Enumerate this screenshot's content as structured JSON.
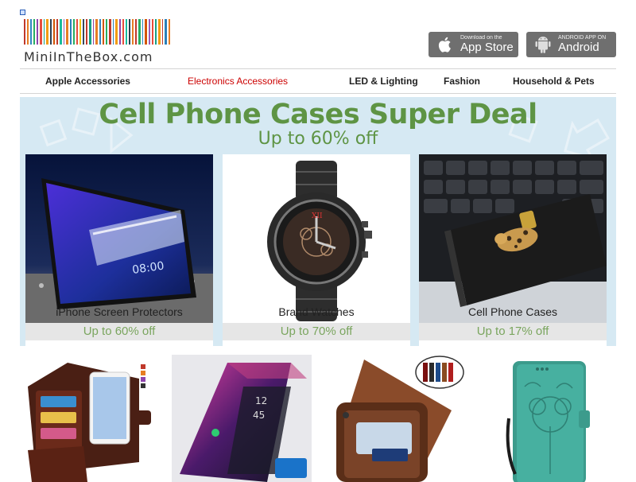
{
  "logo": {
    "text": "MiniInTheBox.com",
    "bar_colors": [
      "#c0392b",
      "#e67e22",
      "#2e86c1",
      "#27ae60",
      "#8e44ad",
      "#e74c3c",
      "#16a085",
      "#f39c12",
      "#2c3e50",
      "#d35400",
      "#c0392b",
      "#1abc9c",
      "#9b59b6",
      "#e67e22",
      "#2980b9",
      "#27ae60",
      "#e74c3c",
      "#f1c40f",
      "#34495e",
      "#c0392b",
      "#16a085",
      "#8e44ad",
      "#e67e22",
      "#2e86c1",
      "#d35400",
      "#27ae60",
      "#c0392b",
      "#2980b9",
      "#f39c12",
      "#8e44ad",
      "#e74c3c",
      "#1abc9c",
      "#2c3e50",
      "#e67e22",
      "#c0392b",
      "#27ae60",
      "#2e86c1",
      "#d35400",
      "#9b59b6",
      "#e74c3c",
      "#16a085",
      "#f39c12",
      "#c0392b",
      "#2980b9",
      "#e67e22"
    ]
  },
  "apps": {
    "ios": {
      "small": "Download on the",
      "big": "App Store",
      "icon": "apple-icon"
    },
    "android": {
      "small": "ANDROID APP ON",
      "big": "Android",
      "icon": "android-icon"
    }
  },
  "nav": [
    {
      "label": "Apple Accessories"
    },
    {
      "label": "Electronics Accessories",
      "active": true
    },
    {
      "label": "LED & Lighting"
    },
    {
      "label": "Fashion"
    },
    {
      "label": "Household & Pets"
    }
  ],
  "banner": {
    "title": "Cell Phone Cases Super Deal",
    "subtitle": "Up to 60% off",
    "deals": [
      {
        "caption": "iPhone Screen Protectors",
        "discount": "Up to 60% off"
      },
      {
        "caption": "Brand Watches",
        "discount": "Up to 70% off"
      },
      {
        "caption": "Cell Phone Cases",
        "discount": "Up to 17% off"
      }
    ]
  },
  "colors": {
    "accent_red": "#cc0000",
    "banner_green": "#5e9444",
    "banner_bg": "#d6e9f3",
    "button_gray": "#6f6f6f"
  }
}
